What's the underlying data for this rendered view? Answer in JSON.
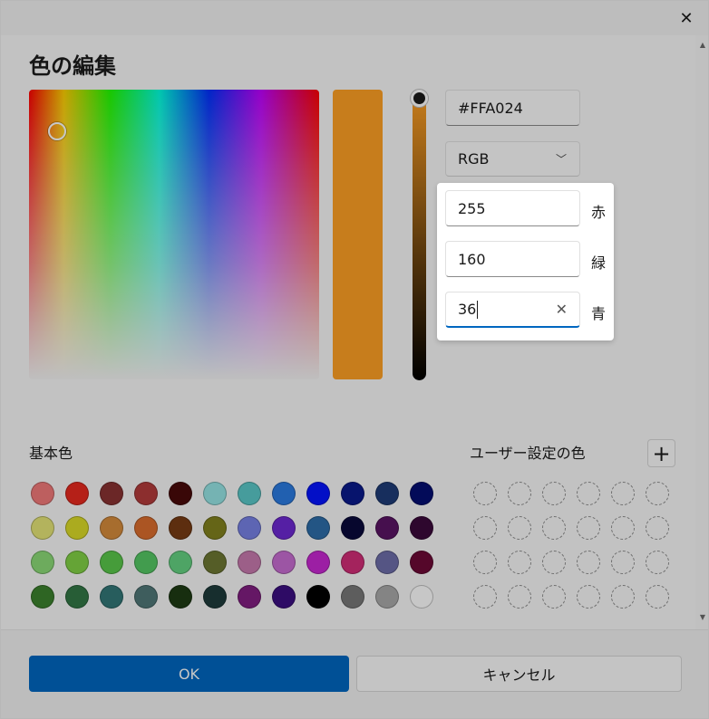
{
  "dialog": {
    "title": "色の編集",
    "close_icon": "close-icon"
  },
  "color": {
    "hex": "#FFA024",
    "preview": "#FFA024"
  },
  "mode": {
    "selected": "RGB",
    "chevron_icon": "chevron-down-icon"
  },
  "rgb": {
    "red_value": "255",
    "red_label": "赤",
    "green_value": "160",
    "green_label": "緑",
    "blue_value": "36",
    "blue_label": "青",
    "clear_icon": "close-icon"
  },
  "basic": {
    "heading": "基本色",
    "colors": [
      "#f27a7a",
      "#e8291f",
      "#8a3232",
      "#b43c3c",
      "#4a0a0a",
      "#96e6e6",
      "#5ac8c8",
      "#2b7be2",
      "#0514ff",
      "#0a1a8c",
      "#1e3c78",
      "#050f73",
      "#e6e678",
      "#dcdc28",
      "#d78c3c",
      "#dc6e2d",
      "#783c14",
      "#82821e",
      "#7882e6",
      "#6e28d2",
      "#2d6eaa",
      "#0a0a3c",
      "#5a1464",
      "#3c0a3c",
      "#8cdc78",
      "#82d246",
      "#5ac84b",
      "#55c864",
      "#64d282",
      "#6e7832",
      "#c87aaf",
      "#c86ed2",
      "#c828d2",
      "#d22d78",
      "#6e6eaa",
      "#6e0a37",
      "#3c822d",
      "#327846",
      "#327878",
      "#507878",
      "#1e3c14",
      "#1e3c3c",
      "#821e82",
      "#3c0f82",
      "#000000",
      "#787878",
      "#aaaaaa",
      "#ffffff"
    ]
  },
  "custom": {
    "heading": "ユーザー設定の色",
    "add_icon": "plus-icon",
    "slots": 24
  },
  "footer": {
    "ok_label": "OK",
    "cancel_label": "キャンセル"
  }
}
